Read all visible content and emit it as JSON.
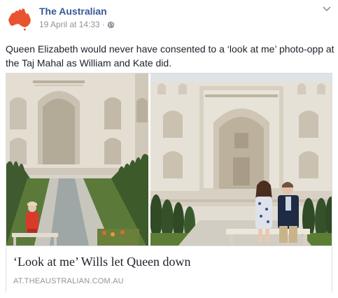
{
  "post": {
    "page_name": "The Australian",
    "timestamp": "19 April at 14:33",
    "separator": "·",
    "message": "Queen Elizabeth would never have consented to a ‘look at me’ photo-opp at the Taj Mahal as William and Kate did.",
    "icons": {
      "avatar": "australia-map-icon",
      "privacy": "globe-icon",
      "options": "chevron-down-icon"
    },
    "colors": {
      "brand": "#e8542f",
      "link": "#365899",
      "meta": "#90949c"
    }
  },
  "link_card": {
    "title": "‘Look at me’ Wills let Queen down",
    "domain": "AT.THEAUSTRALIAN.COM.AU"
  }
}
